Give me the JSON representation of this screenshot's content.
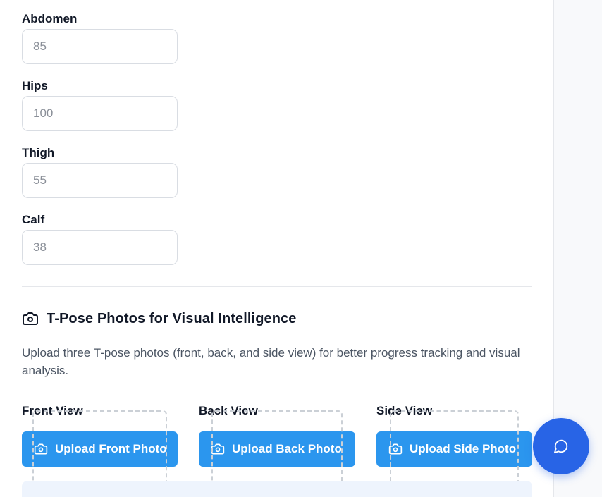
{
  "measurements": [
    {
      "label": "Abdomen",
      "placeholder": "85"
    },
    {
      "label": "Hips",
      "placeholder": "100"
    },
    {
      "label": "Thigh",
      "placeholder": "55"
    },
    {
      "label": "Calf",
      "placeholder": "38"
    }
  ],
  "tpose": {
    "title": "T-Pose Photos for Visual Intelligence",
    "description": "Upload three T-pose photos (front, back, and side view) for better progress tracking and visual analysis.",
    "icon": "camera-icon",
    "views": [
      {
        "label": "Front View",
        "button": "Upload Front Photo"
      },
      {
        "label": "Back View",
        "button": "Upload Back Photo"
      },
      {
        "label": "Side View",
        "button": "Upload Side Photo"
      }
    ]
  },
  "chat": {
    "icon": "chat-bubble-icon"
  },
  "colors": {
    "upload_button": "#2b96ee",
    "chat_fab": "#2864e6",
    "preview_bg": "#eef4fd"
  }
}
